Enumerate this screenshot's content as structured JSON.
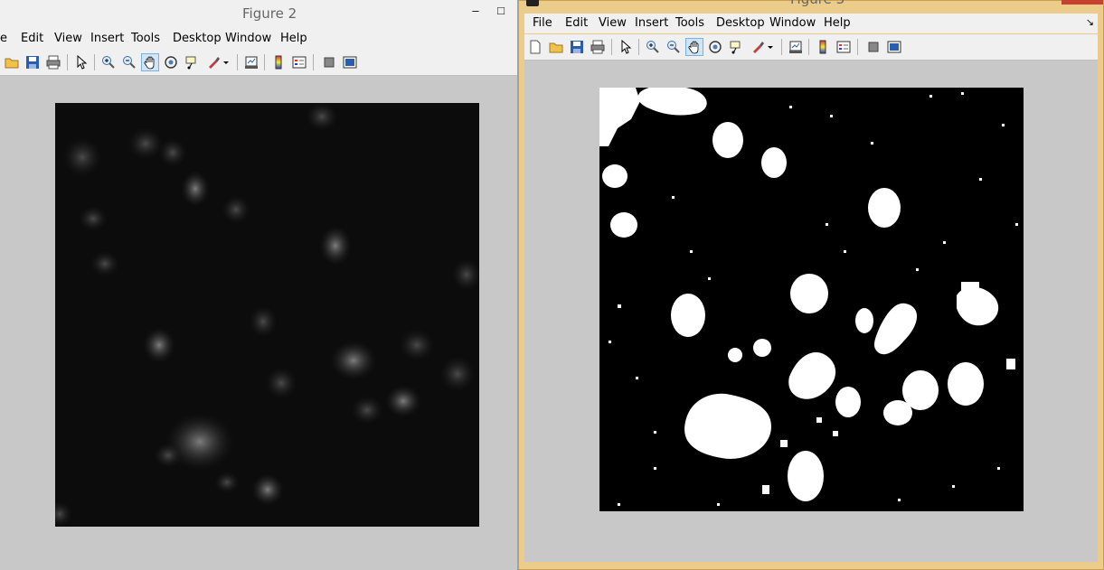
{
  "figure2": {
    "title": "Figure 2",
    "minimize_glyph": "–",
    "maximize_glyph": "□",
    "menu": [
      {
        "label": "e"
      },
      {
        "label": "Edit"
      },
      {
        "label": "View"
      },
      {
        "label": "Insert"
      },
      {
        "label": "Tools"
      },
      {
        "label": "Desktop"
      },
      {
        "label": "Window"
      },
      {
        "label": "Help"
      }
    ],
    "toolbar_icons": [
      "open-file-icon",
      "save-icon",
      "print-icon",
      "select-arrow-icon",
      "zoom-in-icon",
      "zoom-out-icon",
      "pan-hand-icon",
      "rotate-3d-icon",
      "data-cursor-icon",
      "brush-icon",
      "brush-dropdown-icon",
      "link-plot-icon",
      "colorbar-icon",
      "legend-icon",
      "hide-plot-tools-icon",
      "show-plot-tools-icon"
    ],
    "image": "grayscale fluorescence image"
  },
  "figure3": {
    "title": "Figure 3",
    "menu": [
      {
        "label": "File"
      },
      {
        "label": "Edit"
      },
      {
        "label": "View"
      },
      {
        "label": "Insert"
      },
      {
        "label": "Tools"
      },
      {
        "label": "Desktop"
      },
      {
        "label": "Window"
      },
      {
        "label": "Help"
      }
    ],
    "dock_glyph": "↘",
    "toolbar_icons": [
      "new-figure-icon",
      "open-file-icon",
      "save-icon",
      "print-icon",
      "select-arrow-icon",
      "zoom-in-icon",
      "zoom-out-icon",
      "pan-hand-icon",
      "rotate-3d-icon",
      "data-cursor-icon",
      "brush-icon",
      "brush-dropdown-icon",
      "link-plot-icon",
      "colorbar-icon",
      "legend-icon",
      "hide-plot-tools-icon",
      "show-plot-tools-icon"
    ],
    "image": "binary thresholded image"
  },
  "colors": {
    "active_frame": "#eccc8a",
    "canvas_bg": "#c8c8c8",
    "toolbar_active": "#cfe5fa"
  }
}
